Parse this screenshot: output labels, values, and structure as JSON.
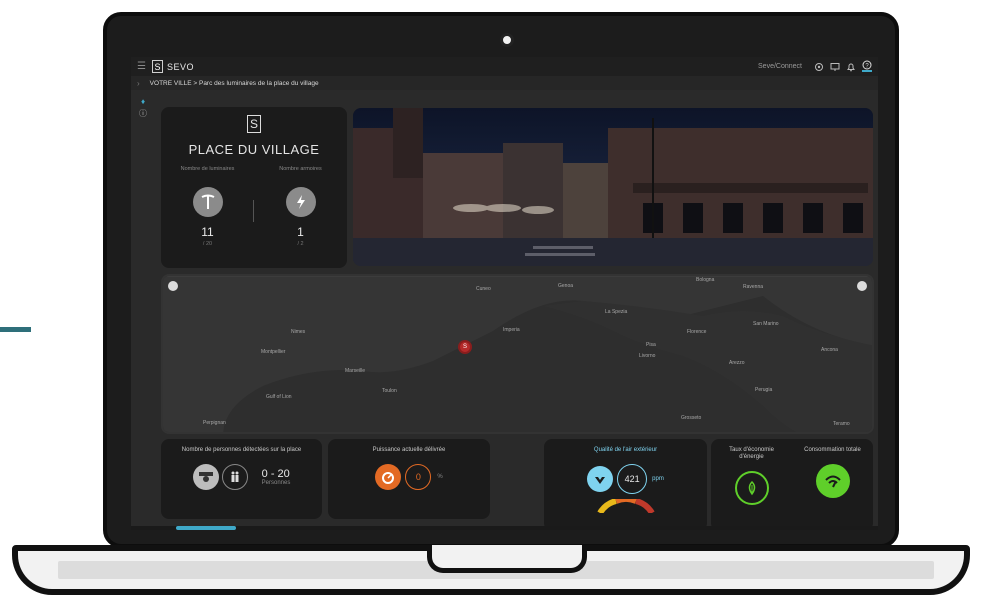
{
  "app": {
    "brand": "SEVO",
    "connect_label": "Seve/Connect"
  },
  "breadcrumb": "VOTRE VILLE > Parc des luminaires de la place du village",
  "place": {
    "title": "PLACE DU VILLAGE",
    "luminaires_label": "Nombre de luminaires",
    "luminaires_value": "11",
    "luminaires_total": "/ 20",
    "armoires_label": "Nombre armoires",
    "armoires_value": "1",
    "armoires_total": "/ 2"
  },
  "map": {
    "marker_label": "S",
    "cities": [
      "Cuneo",
      "Genoa",
      "Bologna",
      "Ravenna",
      "La Spezia",
      "Nimes",
      "Imperia",
      "Florence",
      "San Marino",
      "Montpellier",
      "Pisa",
      "Livorno",
      "Ancona",
      "Marseille",
      "Arezzo",
      "Toulon",
      "Gulf of Lion",
      "Perugia",
      "Perpignan",
      "Grosseto",
      "Teramo"
    ]
  },
  "widgets": {
    "people_title": "Nombre de personnes détectées sur la place",
    "people_value": "0 - 20",
    "people_unit": "Personnes",
    "power_title": "Puissance actuelle délivrée",
    "power_value": "0",
    "power_unit": "%",
    "air_title": "Qualité de l'air extérieur",
    "air_value": "421",
    "air_unit": "ppm",
    "saving_title": "Taux d'économie d'énergie",
    "consumption_title": "Consommation totale"
  },
  "colors": {
    "accent": "#3fa9c9",
    "orange": "#e36a24",
    "green": "#5fcf2a",
    "marker": "#b52a2a"
  }
}
